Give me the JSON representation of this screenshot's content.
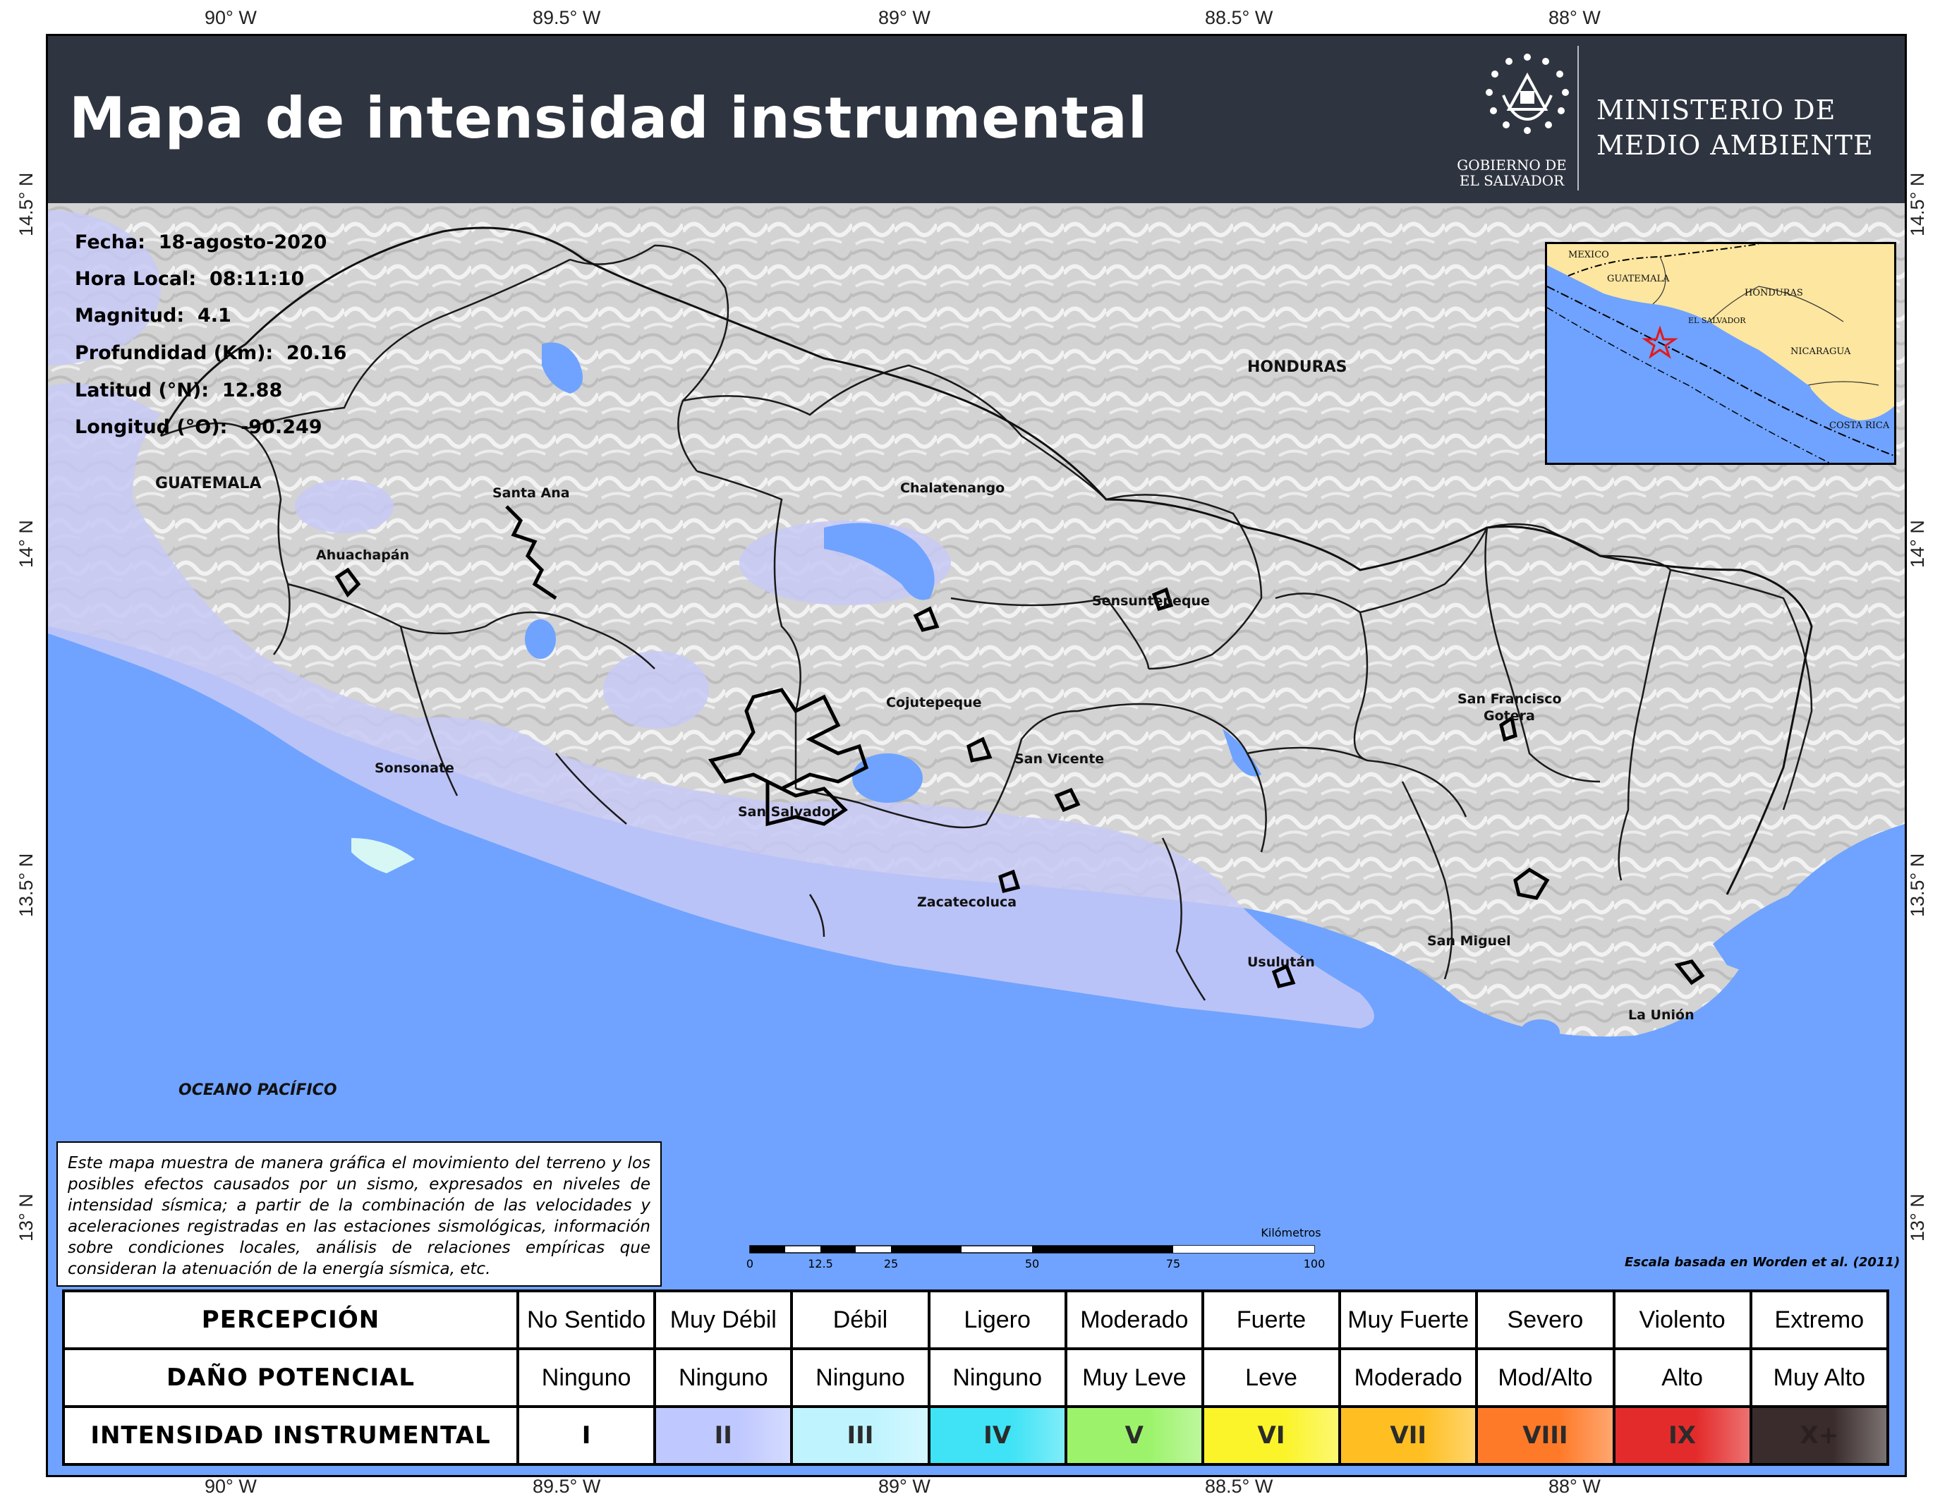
{
  "header": {
    "title": "Mapa de intensidad instrumental",
    "gov_line1": "GOBIERNO DE",
    "gov_line2": "EL SALVADOR",
    "ministry_line1": "MINISTERIO DE",
    "ministry_line2": "MEDIO AMBIENTE"
  },
  "axes": {
    "lon_ticks": [
      "90° W",
      "89.5° W",
      "89° W",
      "88.5° W",
      "88° W"
    ],
    "lat_ticks": [
      "14.5° N",
      "14° N",
      "13.5° N",
      "13° N"
    ]
  },
  "event": {
    "fecha_label": "Fecha:",
    "fecha": "18-agosto-2020",
    "hora_label": "Hora Local:",
    "hora": "08:11:10",
    "magnitud_label": "Magnitud:",
    "magnitud": "4.1",
    "profundidad_label": "Profundidad (Km):",
    "profundidad": "20.16",
    "latitud_label": "Latitud (°N):",
    "latitud": "12.88",
    "longitud_label": "Longitud (°O):",
    "longitud": "-90.249"
  },
  "countries": {
    "guatemala": "GUATEMALA",
    "honduras": "HONDURAS",
    "ocean": "OCEANO PACÍFICO"
  },
  "cities": {
    "santa_ana": "Santa Ana",
    "chalatenango": "Chalatenango",
    "ahuachapan": "Ahuachapán",
    "sensuntepeque": "Sensuntepeque",
    "cojutepeque": "Cojutepeque",
    "sonsonate": "Sonsonate",
    "san_vicente": "San Vicente",
    "san_francisco_1": "San Francisco",
    "san_francisco_2": "Gotera",
    "san_salvador": "San Salvador",
    "zacatecoluca": "Zacatecoluca",
    "san_miguel": "San Miguel",
    "usulutan": "Usulután",
    "la_union": "La Unión"
  },
  "inset": {
    "mexico": "MEXICO",
    "guatemala": "GUATEMALA",
    "honduras": "HONDURAS",
    "el_salvador": "EL SALVADOR",
    "nicaragua": "NICARAGUA",
    "costa_rica": "COSTA RICA"
  },
  "description": "Este mapa muestra de manera gráfica el movimiento del terreno y los posibles efectos causados por un sismo, expresados en niveles de intensidad sísmica; a partir de la combinación de las velocidades y aceleraciones registradas en las estaciones sismológicas, información sobre condiciones locales, análisis de relaciones empíricas que consideran la atenuación de la energía sísmica, etc.",
  "scale": {
    "unit": "Kilómetros",
    "labels": [
      "0",
      "12.5",
      "25",
      "50",
      "75",
      "100"
    ],
    "credit": "Escala basada en Worden et al. (2011)"
  },
  "legend": {
    "row_headers": [
      "PERCEPCIÓN",
      "DAÑO POTENCIAL",
      "INTENSIDAD INSTRUMENTAL"
    ],
    "percepcion": [
      "No Sentido",
      "Muy Débil",
      "Débil",
      "Ligero",
      "Moderado",
      "Fuerte",
      "Muy Fuerte",
      "Severo",
      "Violento",
      "Extremo"
    ],
    "dano": [
      "Ninguno",
      "Ninguno",
      "Ninguno",
      "Ninguno",
      "Muy Leve",
      "Leve",
      "Moderado",
      "Mod/Alto",
      "Alto",
      "Muy Alto"
    ],
    "intensidad": [
      "I",
      "II",
      "III",
      "IV",
      "V",
      "VI",
      "VII",
      "VIII",
      "IX",
      "X+"
    ],
    "colors": [
      "#ffffff",
      "#bfc8ff",
      "#bff4ff",
      "#3fe3f5",
      "#9cf36b",
      "#fbf42a",
      "#ffbf22",
      "#ff7a28",
      "#e42b2b",
      "#3a2c2c"
    ]
  },
  "colors": {
    "header_bg": "#2f3540",
    "ocean": "#6fa3ff",
    "intensity_ii": "#c6c8f7",
    "intensity_iii": "#d6f7f4",
    "land": "#d9d9d9",
    "inset_land": "#fde6a0",
    "epicenter": "#e01a1a"
  }
}
